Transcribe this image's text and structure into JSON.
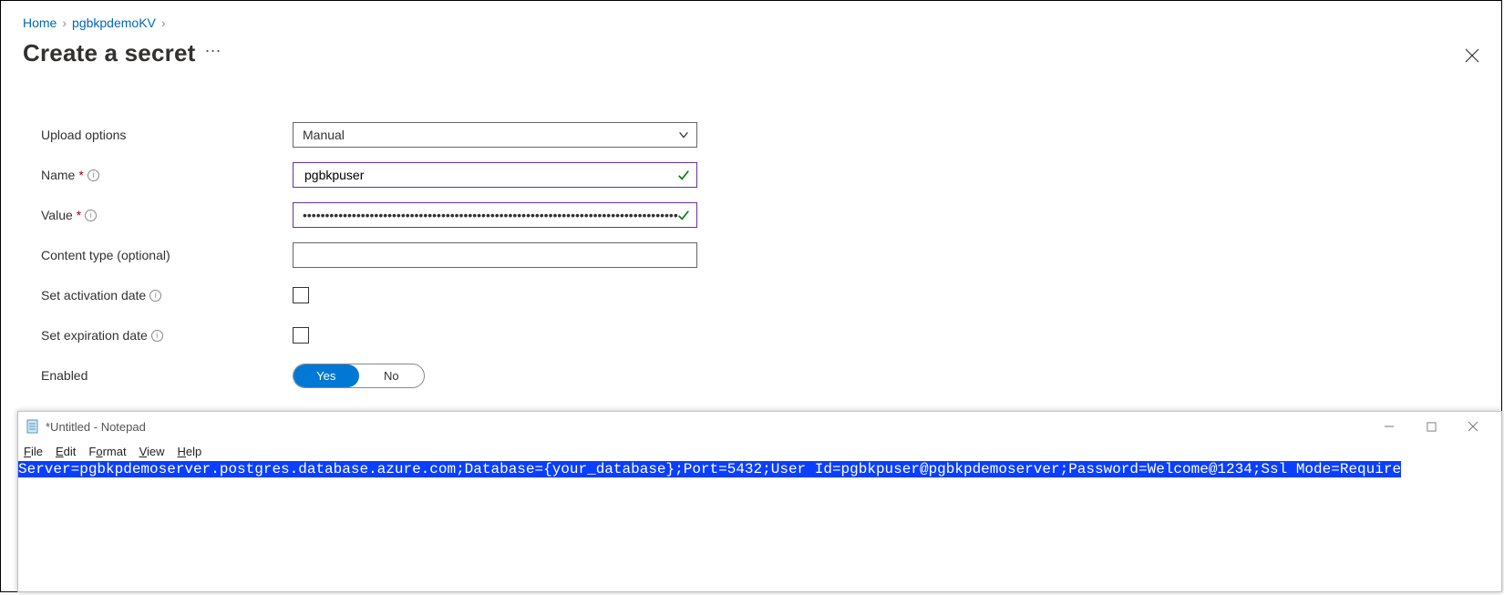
{
  "breadcrumb": {
    "home": "Home",
    "kv": "pgbkpdemoKV"
  },
  "page": {
    "title": "Create a secret"
  },
  "form": {
    "upload_label": "Upload options",
    "upload_value": "Manual",
    "name_label": "Name",
    "name_value": "pgbkpuser",
    "value_label": "Value",
    "value_masked": "••••••••••••••••••••••••••••••••••••••••••••••••••••••••••••••••••••••••••••••••••••",
    "content_type_label": "Content type (optional)",
    "content_type_value": "",
    "activation_label": "Set activation date",
    "expiration_label": "Set expiration date",
    "enabled_label": "Enabled",
    "enabled_yes": "Yes",
    "enabled_no": "No"
  },
  "notepad": {
    "title": "*Untitled - Notepad",
    "menu": {
      "file": "File",
      "edit": "Edit",
      "format": "Format",
      "view": "View",
      "help": "Help"
    },
    "content": "Server=pgbkpdemoserver.postgres.database.azure.com;Database={your_database};Port=5432;User Id=pgbkpuser@pgbkpdemoserver;Password=Welcome@1234;Ssl Mode=Require"
  }
}
